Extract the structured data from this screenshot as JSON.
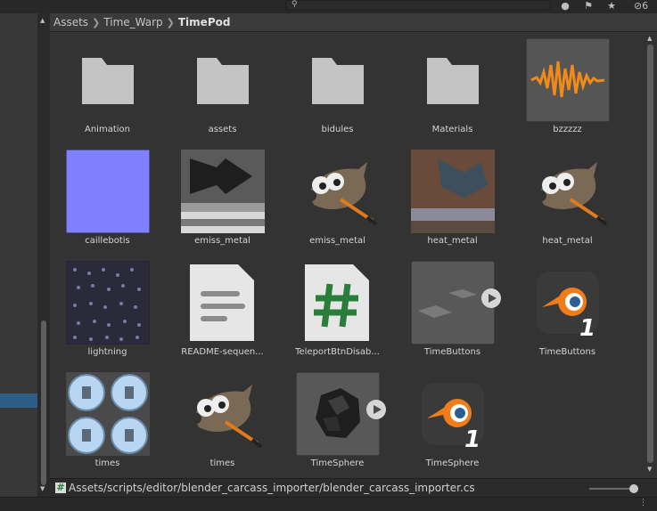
{
  "toolbar": {
    "hidden_count": "6"
  },
  "breadcrumb": [
    "Assets",
    "Time_Warp",
    "TimePod"
  ],
  "items": [
    {
      "label": "Animation",
      "kind": "folder"
    },
    {
      "label": "assets",
      "kind": "folder"
    },
    {
      "label": "bidules",
      "kind": "folder"
    },
    {
      "label": "Materials",
      "kind": "folder"
    },
    {
      "label": "bzzzzz",
      "kind": "audio"
    },
    {
      "label": "caillebotis",
      "kind": "texture-flat"
    },
    {
      "label": "emiss_metal",
      "kind": "texture-metal"
    },
    {
      "label": "emiss_metal",
      "kind": "gimp"
    },
    {
      "label": "heat_metal",
      "kind": "texture-rust"
    },
    {
      "label": "heat_metal",
      "kind": "gimp"
    },
    {
      "label": "lightning",
      "kind": "texture-noise"
    },
    {
      "label": "README-sequen...",
      "kind": "document"
    },
    {
      "label": "TeleportBtnDisab...",
      "kind": "script"
    },
    {
      "label": "TimeButtons",
      "kind": "prefab"
    },
    {
      "label": "TimeButtons",
      "kind": "blender"
    },
    {
      "label": "times",
      "kind": "texture-times"
    },
    {
      "label": "times",
      "kind": "gimp"
    },
    {
      "label": "TimeSphere",
      "kind": "prefab-sphere"
    },
    {
      "label": "TimeSphere",
      "kind": "blender"
    }
  ],
  "status": {
    "path": "Assets/scripts/editor/blender_carcass_importer/blender_carcass_importer.cs"
  },
  "colors": {
    "accent": "#2c5d87",
    "flat_texture": "#8080ff",
    "blender_orange": "#f07c1a"
  }
}
